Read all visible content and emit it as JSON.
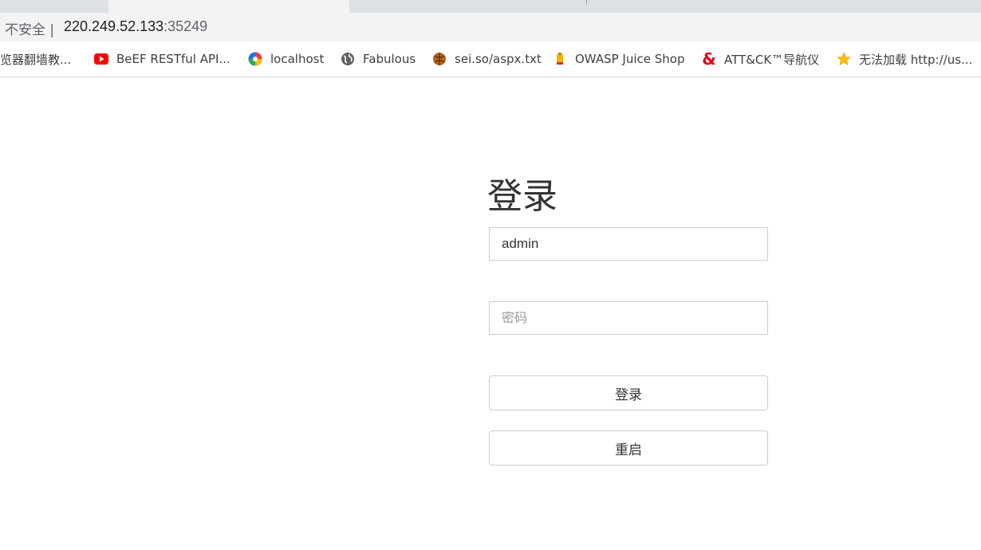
{
  "browser": {
    "security_label": "不安全 |",
    "url_host": "220.249.52.133",
    "url_port": ":35249"
  },
  "bookmarks": [
    {
      "label": "览器翻墙教...",
      "icon": "none"
    },
    {
      "label": "BeEF RESTful API...",
      "icon": "youtube-icon",
      "color": "#ff0000"
    },
    {
      "label": "localhost",
      "icon": "colorful-logo-icon"
    },
    {
      "label": "Fabulous",
      "icon": "globe-icon",
      "color": "#5f6368"
    },
    {
      "label": "sei.so/aspx.txt",
      "icon": "ball-icon",
      "color": "#b5651d"
    },
    {
      "label": "OWASP Juice Shop",
      "icon": "juice-icon",
      "color": "#f4b400"
    },
    {
      "label": "ATT&CK™导航仪",
      "icon": "ampersand-icon",
      "color": "#e60012"
    },
    {
      "label": "无法加载 http://us...",
      "icon": "star-icon",
      "color": "#fbbc04"
    }
  ],
  "login": {
    "title": "登录",
    "username_value": "admin",
    "password_placeholder": "密码",
    "submit_label": "登录",
    "reset_label": "重启"
  }
}
